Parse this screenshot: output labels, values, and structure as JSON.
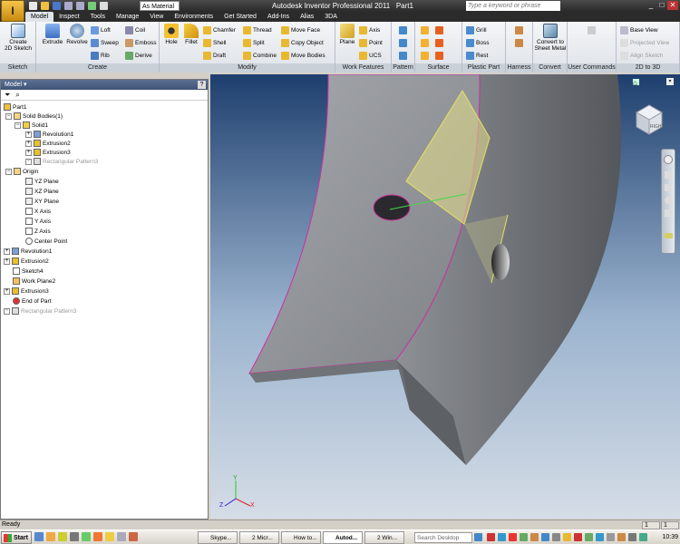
{
  "window": {
    "title": "Autodesk Inventor Professional 2011",
    "doc": "Part1"
  },
  "qat": {
    "material": "As Material"
  },
  "search": {
    "placeholder": "Type a keyword or phrase"
  },
  "tabs": [
    "Model",
    "Inspect",
    "Tools",
    "Manage",
    "View",
    "Environments",
    "Get Started",
    "Add-Ins",
    "Alias",
    "3DA"
  ],
  "ribbon": {
    "sketch": {
      "label": "Sketch",
      "create": "Create",
      "create2": "2D Sketch"
    },
    "create": {
      "label": "Create",
      "extrude": "Extrude",
      "revolve": "Revolve",
      "loft": "Loft",
      "sweep": "Sweep",
      "rib": "Rib",
      "coil": "Coil",
      "emboss": "Emboss",
      "derive": "Derive"
    },
    "modify": {
      "label": "Modify",
      "hole": "Hole",
      "fillet": "Fillet",
      "chamfer": "Chamfer",
      "shell": "Shell",
      "draft": "Draft",
      "thread": "Thread",
      "split": "Split",
      "combine": "Combine",
      "moveface": "Move Face",
      "copyobject": "Copy Object",
      "movebodies": "Move Bodies"
    },
    "workfeatures": {
      "label": "Work Features",
      "plane": "Plane",
      "axis": "Axis",
      "point": "Point",
      "ucs": "UCS"
    },
    "pattern": {
      "label": "Pattern"
    },
    "surface": {
      "label": "Surface"
    },
    "plastic": {
      "label": "Plastic Part",
      "grill": "Grill",
      "boss": "Boss",
      "rest": "Rest"
    },
    "harness": {
      "label": "Harness"
    },
    "convert": {
      "label": "Convert",
      "btn1": "Convert to",
      "btn2": "Sheet Metal"
    },
    "usercmd": {
      "label": "User Commands"
    },
    "twod": {
      "label": "2D to 3D",
      "baseview": "Base View",
      "projected": "Projected View",
      "align": "Align Sketch"
    }
  },
  "browser": {
    "title": "Model",
    "nodes": [
      {
        "label": "Part1"
      },
      {
        "label": "Solid Bodies(1)"
      },
      {
        "label": "Solid1"
      },
      {
        "label": "Revolution1"
      },
      {
        "label": "Extrusion2"
      },
      {
        "label": "Extrusion3"
      },
      {
        "label": "Rectangular Pattern3"
      },
      {
        "label": "Origin"
      },
      {
        "label": "YZ Plane"
      },
      {
        "label": "XZ Plane"
      },
      {
        "label": "XY Plane"
      },
      {
        "label": "X Axis"
      },
      {
        "label": "Y Axis"
      },
      {
        "label": "Z Axis"
      },
      {
        "label": "Center Point"
      },
      {
        "label": "Revolution1"
      },
      {
        "label": "Extrusion2"
      },
      {
        "label": "Sketch4"
      },
      {
        "label": "Work Plane2"
      },
      {
        "label": "Extrusion3"
      },
      {
        "label": "End of Part"
      },
      {
        "label": "Rectangular Pattern3"
      }
    ]
  },
  "viewcube": {
    "face": "RIGHT"
  },
  "triad": {
    "x": "X",
    "y": "Y",
    "z": "Z"
  },
  "status": {
    "text": "Ready",
    "c1": "1",
    "c2": "1"
  },
  "taskbar": {
    "start": "Start",
    "items": [
      "Skype...",
      "2 Micr...",
      "How to...",
      "Autod...",
      "2 Win..."
    ],
    "search": "Search Desktop",
    "clock": "10:39"
  },
  "colors": {
    "accent": "#f4a91e",
    "viewport_top": "#1e3f6e",
    "part": "#8a8d92",
    "workplane": "#e6e08a"
  }
}
